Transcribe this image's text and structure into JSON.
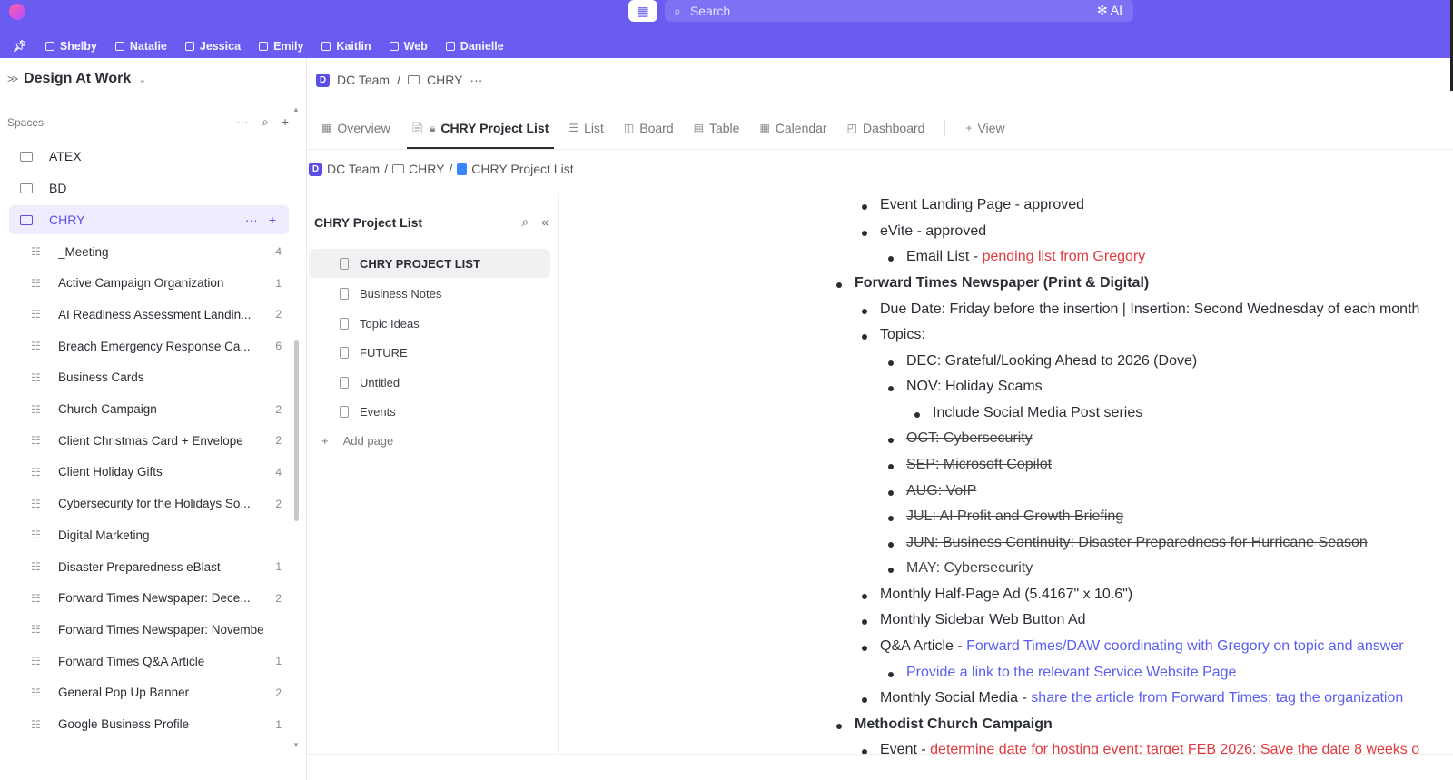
{
  "topbar": {
    "search_placeholder": "Search",
    "ai_label": "AI",
    "favorites": [
      "Shelby",
      "Natalie",
      "Jessica",
      "Emily",
      "Kaitlin",
      "Web",
      "Danielle"
    ]
  },
  "sidebar": {
    "workspace": "Design At Work",
    "spaces_label": "Spaces",
    "spaces": [
      "ATEX",
      "BD",
      "CHRY"
    ],
    "lists": [
      {
        "name": "_Meeting",
        "count": "4"
      },
      {
        "name": "Active Campaign Organization",
        "count": "1"
      },
      {
        "name": "AI Readiness Assessment Landin...",
        "count": "2"
      },
      {
        "name": "Breach Emergency Response Ca...",
        "count": "6"
      },
      {
        "name": "Business Cards",
        "count": ""
      },
      {
        "name": "Church Campaign",
        "count": "2"
      },
      {
        "name": "Client Christmas Card + Envelope",
        "count": "2"
      },
      {
        "name": "Client Holiday Gifts",
        "count": "4"
      },
      {
        "name": "Cybersecurity for the Holidays So...",
        "count": "2"
      },
      {
        "name": "Digital Marketing",
        "count": ""
      },
      {
        "name": "Disaster Preparedness eBlast",
        "count": "1"
      },
      {
        "name": "Forward Times Newspaper: Dece...",
        "count": "2"
      },
      {
        "name": "Forward Times Newspaper: November",
        "count": ""
      },
      {
        "name": "Forward Times Q&A Article",
        "count": "1"
      },
      {
        "name": "General Pop Up Banner",
        "count": "2"
      },
      {
        "name": "Google Business Profile",
        "count": "1"
      }
    ]
  },
  "header": {
    "crumb_team": "DC Team",
    "crumb_sep": "/",
    "crumb_folder": "CHRY",
    "more": "···",
    "tabs": [
      "Overview",
      "CHRY Project List",
      "List",
      "Board",
      "Table",
      "Calendar",
      "Dashboard",
      "View"
    ],
    "crumb2_doc": "CHRY Project List"
  },
  "pages_panel": {
    "title": "CHRY Project List",
    "pages": [
      "CHRY PROJECT LIST",
      "Business Notes",
      "Topic Ideas",
      "FUTURE",
      "Untitled",
      "Events"
    ],
    "add_page": "Add page"
  },
  "doc": {
    "l1": "Event Landing Page - approved",
    "l2": "eVite - approved",
    "l3a": "Email List - ",
    "l3b": "pending list from Gregory",
    "l4": "Forward Times Newspaper (Print & Digital)",
    "l5": "Due Date: Friday before the insertion | Insertion: Second Wednesday of each month",
    "l6": "Topics:",
    "l7": "DEC: Grateful/Looking Ahead to 2026 (Dove)",
    "l8": "NOV: Holiday Scams",
    "l9": "Include Social Media Post series",
    "l10": "OCT: Cybersecurity",
    "l11": "SEP: Microsoft Copilot",
    "l12": "AUG: VoIP",
    "l13": "JUL: AI Profit and Growth Briefing",
    "l14": "JUN: Business Continuity: Disaster Preparedness for Hurricane Season",
    "l15": "MAY: Cybersecurity",
    "l16": "Monthly Half-Page Ad (5.4167\" x 10.6\")",
    "l17": "Monthly Sidebar Web Button Ad",
    "l18a": "Q&A Article - ",
    "l18b": "Forward Times/DAW coordinating with Gregory on topic and answer",
    "l19": "Provide a link to the relevant Service Website Page",
    "l20a": "Monthly Social Media - ",
    "l20b": "share the article from Forward Times; tag the organization",
    "l21": "Methodist Church Campaign",
    "l22a": "Event - ",
    "l22b": "determine date for hosting event; target FEB 2026; Save the date 8 weeks o"
  },
  "colors": {
    "brand": "#6a5cf0",
    "accent": "#5b4ee6",
    "red": "#e0393e",
    "link": "#5b5ef0"
  }
}
